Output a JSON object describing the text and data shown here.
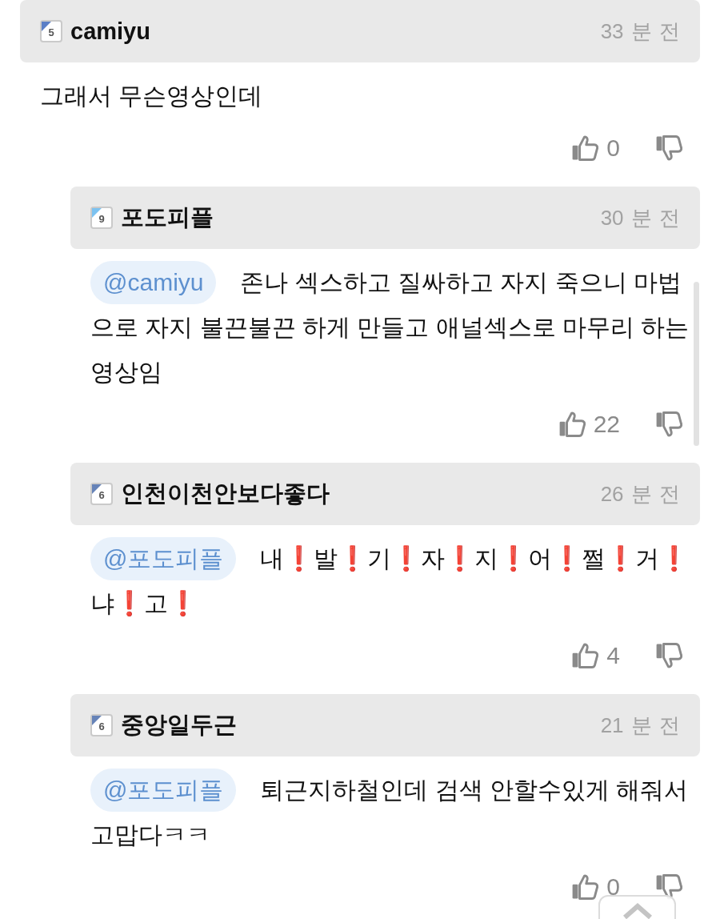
{
  "comments": [
    {
      "user": "camiyu",
      "badge": {
        "level": "5",
        "color": "#5b7fc6"
      },
      "time": "33 분 전",
      "text": "그래서 무슨영상인데",
      "likes": "0",
      "children": [
        {
          "user": "포도피플",
          "badge": {
            "level": "9",
            "color": "#7cc2f0"
          },
          "time": "30 분 전",
          "mention": "@camiyu",
          "text": "존나 섹스하고 질싸하고 자지 죽으니 마법으로 자지 불끈불끈 하게 만들고 애널섹스로 마무리 하는 영상임",
          "likes": "22"
        },
        {
          "user": "인천이천안보다좋다",
          "badge": {
            "level": "6",
            "color": "#6683b8"
          },
          "time": "26 분 전",
          "mention": "@포도피플",
          "text": "내❗발❗기❗자❗지❗어❗쩔❗거❗냐❗고❗",
          "likes": "4"
        },
        {
          "user": "중앙일두근",
          "badge": {
            "level": "6",
            "color": "#6683b8"
          },
          "time": "21 분 전",
          "mention": "@포도피플",
          "text": "퇴근지하철인데 검색 안할수있게 해줘서 고맙다ㅋㅋ",
          "likes": "0"
        }
      ]
    }
  ]
}
